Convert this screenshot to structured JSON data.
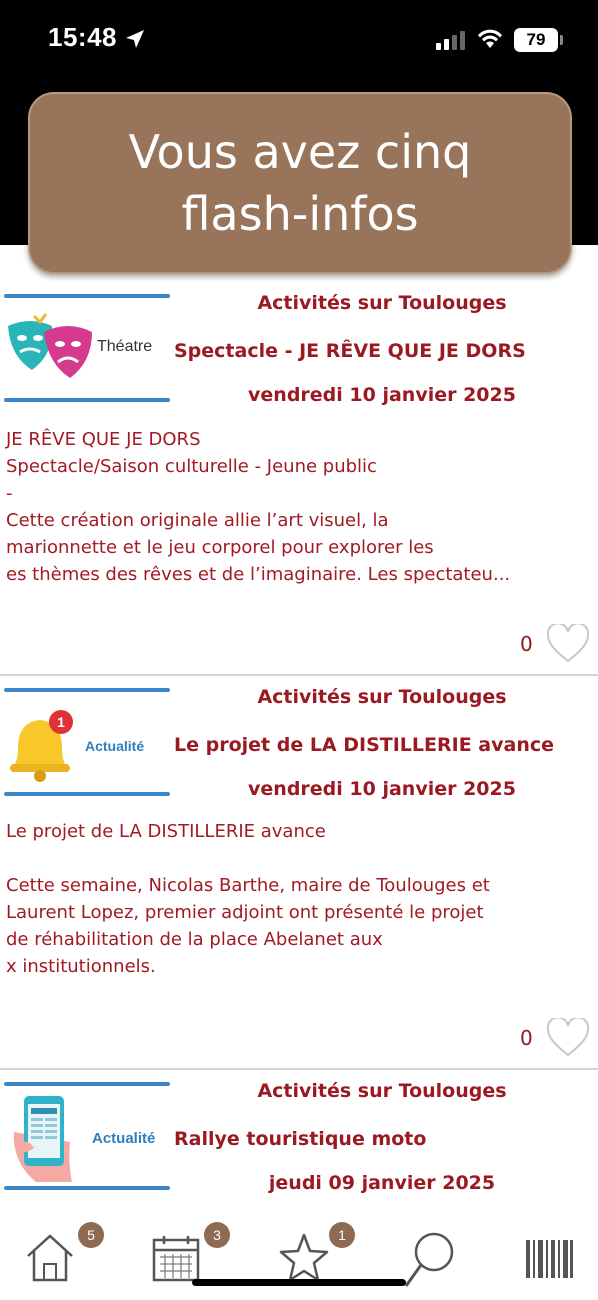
{
  "status": {
    "time": "15:48",
    "battery": "79"
  },
  "banner": {
    "title": "Vous avez cinq flash-infos"
  },
  "cards": [
    {
      "thumb_label": "Théatre",
      "category": "Activités sur Toulouges",
      "title": "Spectacle - JE RÊVE QUE JE DORS",
      "date": "vendredi 10 janvier 2025",
      "body": "JE RÊVE QUE JE DORS\nSpectacle/Saison culturelle - Jeune public\n-\nCette création originale allie l’art visuel, la\nmarionnette et le jeu corporel pour explorer les\nes thèmes des rêves et de l’imaginaire. Les spectateu...",
      "likes": "0"
    },
    {
      "thumb_label": "Actualité",
      "thumb_badge": "1",
      "category": "Activités sur Toulouges",
      "title": "Le projet de LA DISTILLERIE avance",
      "date": "vendredi 10 janvier 2025",
      "body": "Le projet de LA DISTILLERIE avance\n\nCette semaine, Nicolas Barthe, maire de Toulouges et\nLaurent Lopez, premier adjoint ont présenté le projet\nde réhabilitation de la place Abelanet aux\nx institutionnels.",
      "likes": "0"
    },
    {
      "thumb_label": "Actualité",
      "category": "Activités sur Toulouges",
      "title": "Rallye touristique moto",
      "date": "jeudi 09 janvier 2025"
    }
  ],
  "tabbar": {
    "home_badge": "5",
    "calendar_badge": "3",
    "favorites_badge": "1"
  },
  "colors": {
    "banner": "#98745a",
    "accent": "#9b1a22",
    "badge": "#8e6a53"
  }
}
